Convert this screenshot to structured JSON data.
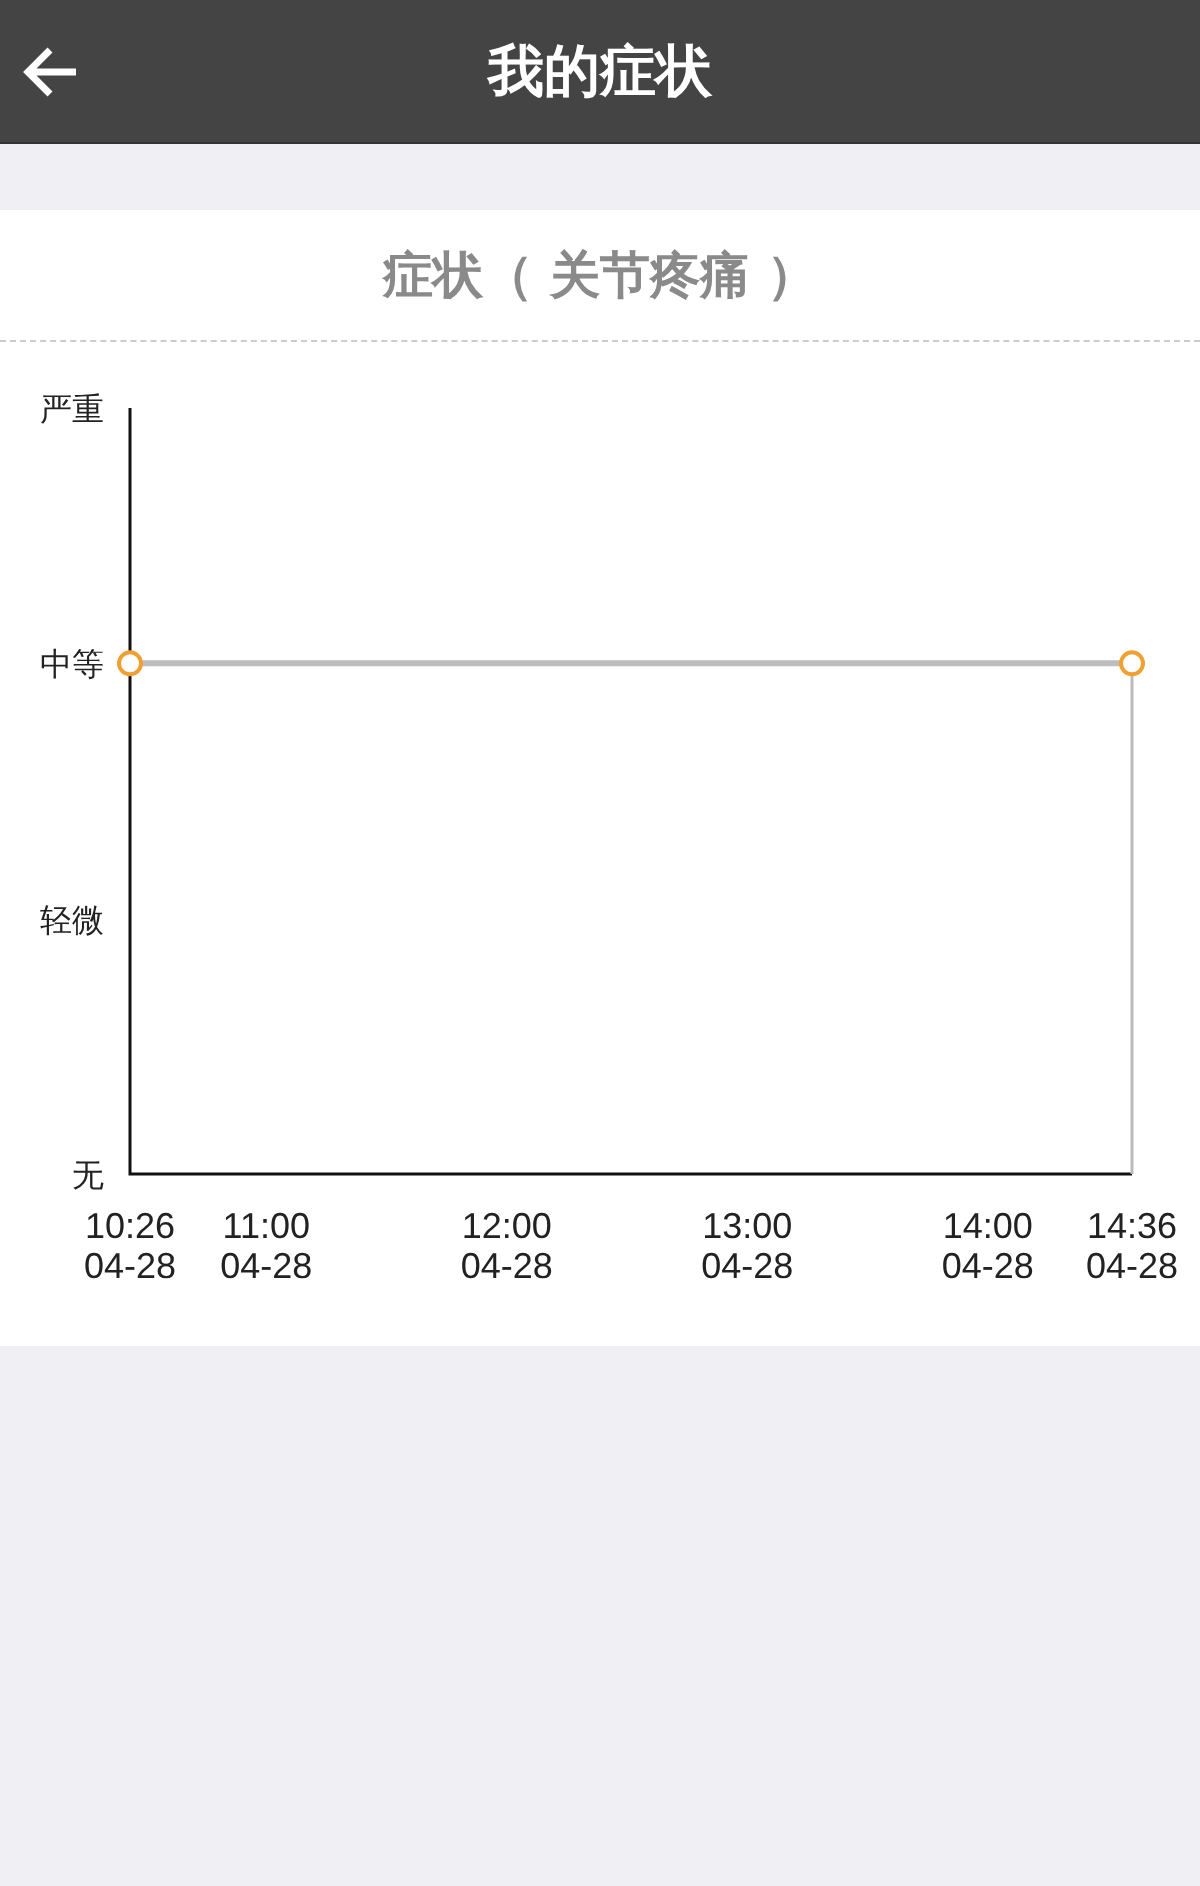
{
  "header": {
    "title": "我的症状"
  },
  "card": {
    "title": "症状（ 关节疼痛 ）",
    "y_axis_labels": [
      "严重",
      "中等",
      "轻微",
      "无"
    ],
    "x_axis_labels": [
      {
        "time": "10:26",
        "date": "04-28"
      },
      {
        "time": "11:00",
        "date": "04-28"
      },
      {
        "time": "12:00",
        "date": "04-28"
      },
      {
        "time": "13:00",
        "date": "04-28"
      },
      {
        "time": "14:00",
        "date": "04-28"
      },
      {
        "time": "14:36",
        "date": "04-28"
      }
    ]
  }
}
